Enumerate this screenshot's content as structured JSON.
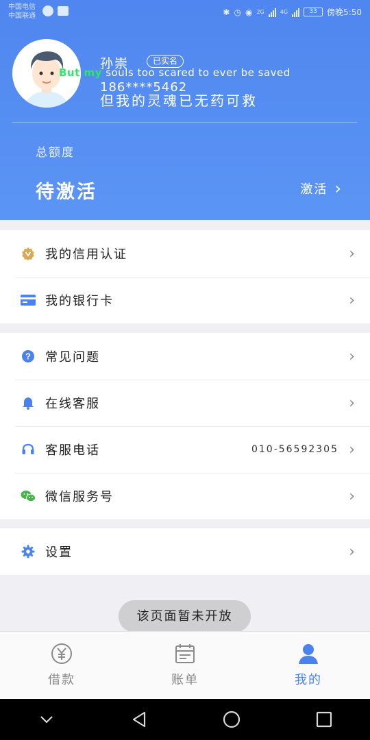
{
  "status_bar": {
    "carrier_1": "中国电信",
    "carrier_2": "中国联通",
    "network_1": "2G",
    "network_2": "4G",
    "battery": "33",
    "time": "傍晚5:50"
  },
  "profile": {
    "name": "孙崇",
    "verified_badge": "已实名",
    "lyric_en_prefix": "But my",
    "lyric_en_rest": " souls too scared to ever be saved",
    "phone": "186****5462",
    "lyric_zh": "但我的灵魂已无药可救"
  },
  "quota": {
    "label": "总额度",
    "status": "待激活",
    "action": "激活"
  },
  "menu_group_1": [
    {
      "label": "我的信用认证",
      "icon": "verified-badge-icon"
    },
    {
      "label": "我的银行卡",
      "icon": "bank-card-icon"
    }
  ],
  "menu_group_2": [
    {
      "label": "常见问题",
      "icon": "question-icon"
    },
    {
      "label": "在线客服",
      "icon": "bell-icon"
    },
    {
      "label": "客服电话",
      "icon": "headset-icon",
      "value": "010-56592305"
    },
    {
      "label": "微信服务号",
      "icon": "wechat-icon"
    }
  ],
  "menu_group_3": [
    {
      "label": "设置",
      "icon": "gear-icon"
    }
  ],
  "toast": "该页面暂未开放",
  "tabs": [
    {
      "label": "借款",
      "icon": "yen-circle-icon"
    },
    {
      "label": "账单",
      "icon": "calendar-icon"
    },
    {
      "label": "我的",
      "icon": "person-icon",
      "active": true
    }
  ],
  "colors": {
    "primary": "#4a83ee",
    "header_top": "#4f86ef",
    "icon_gold": "#d9a850",
    "icon_blue": "#4a83ee",
    "wechat_green": "#44b549"
  }
}
